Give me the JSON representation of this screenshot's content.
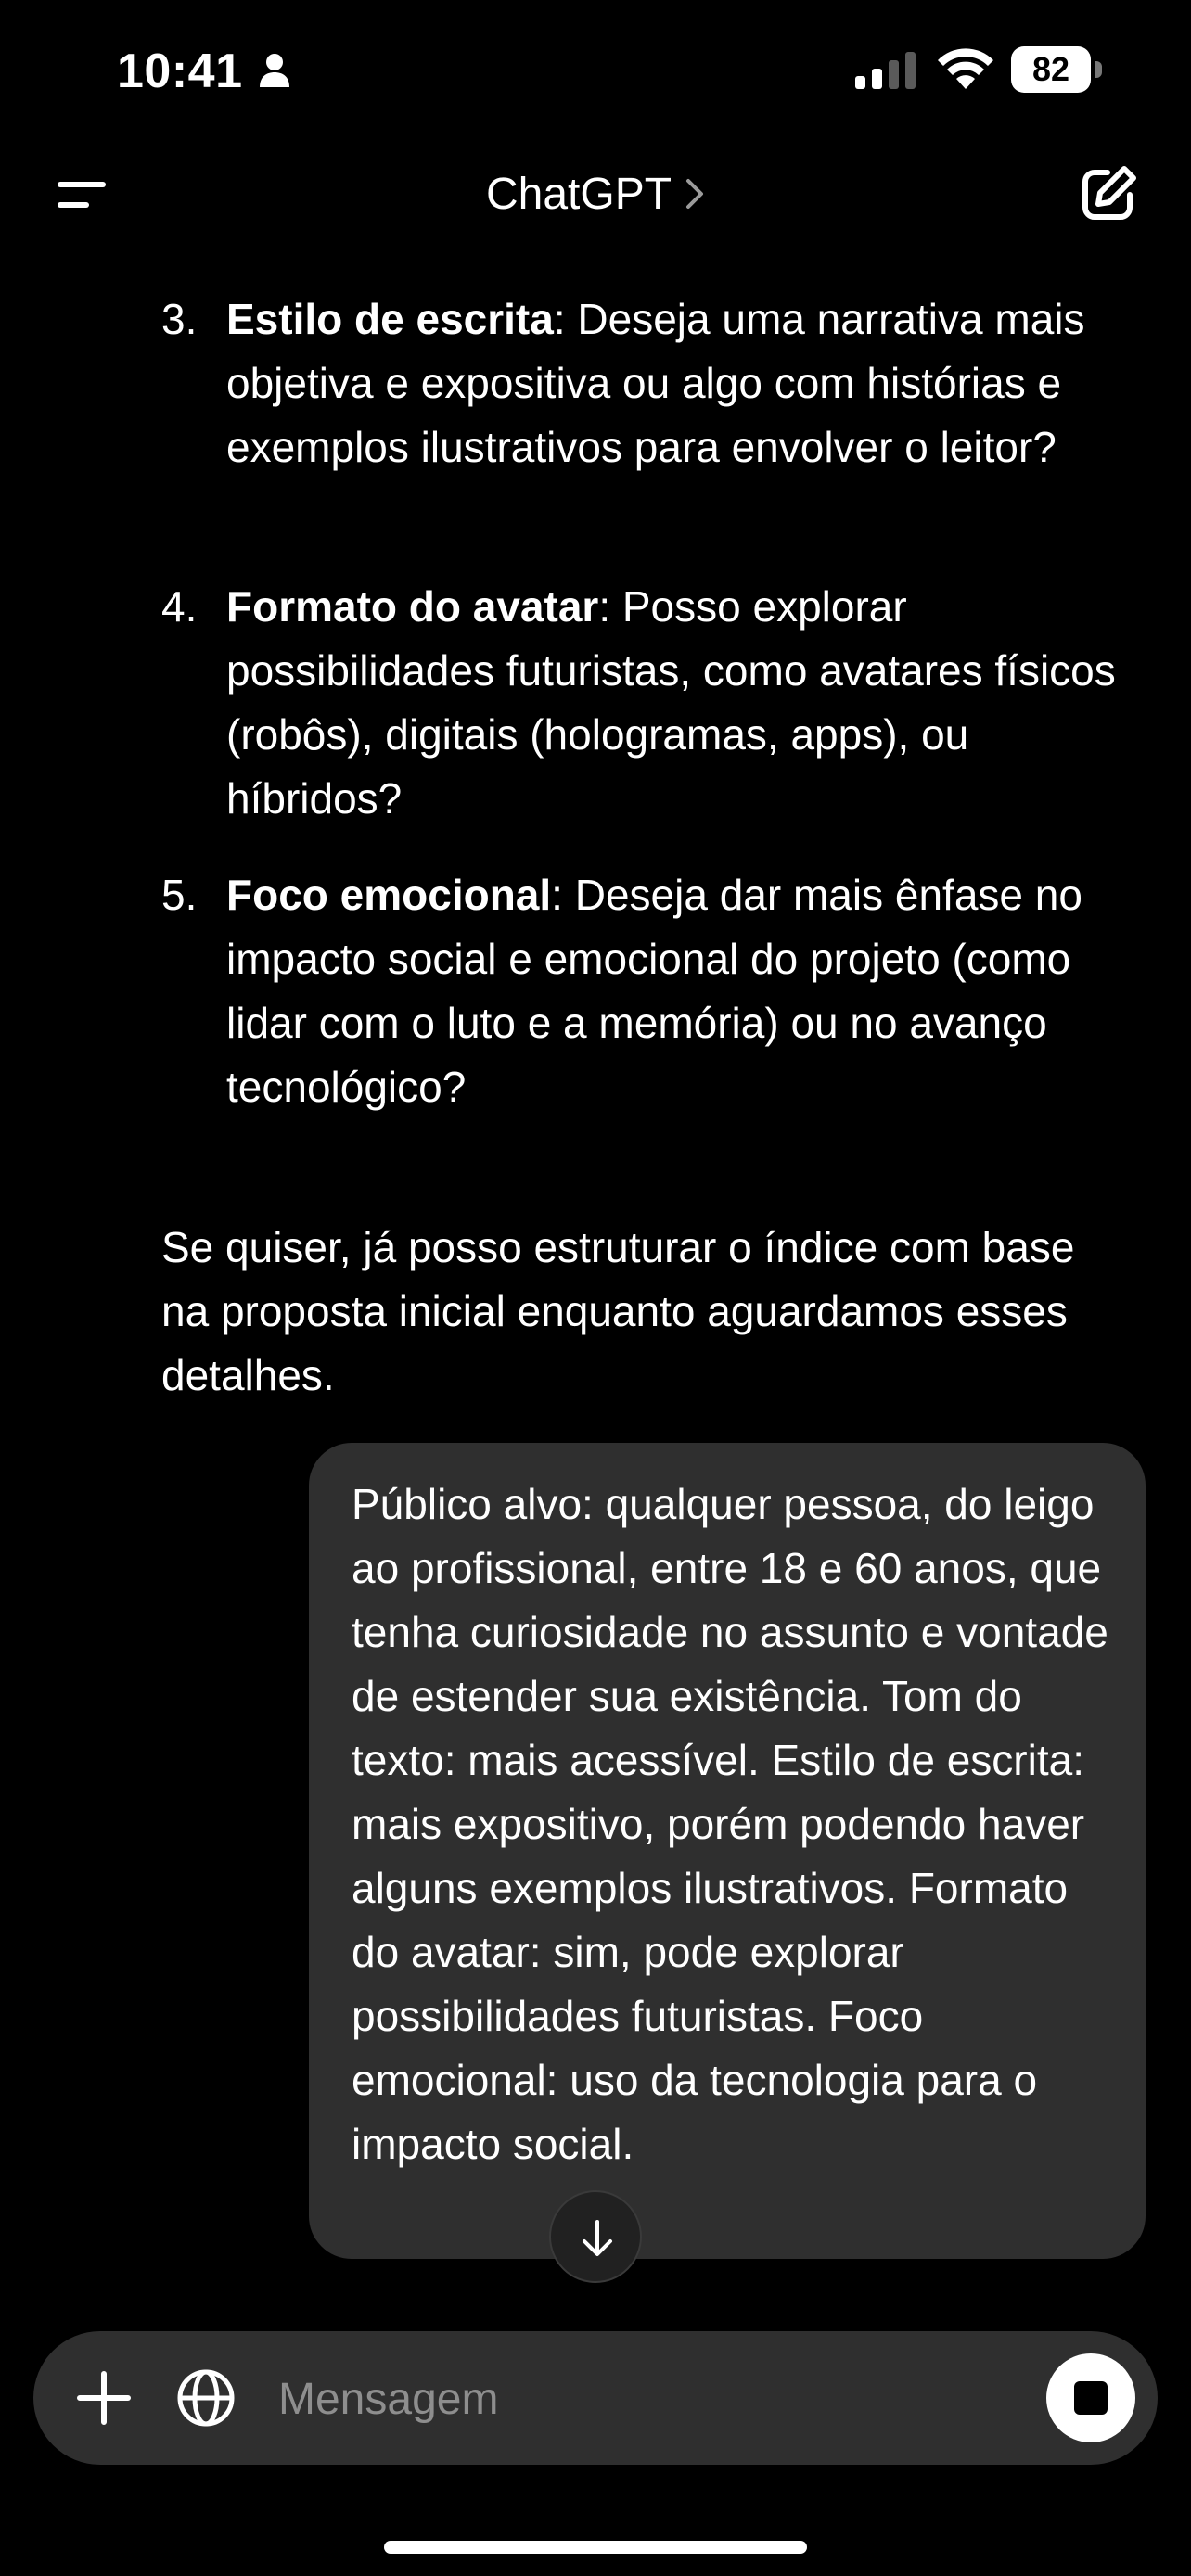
{
  "status_bar": {
    "time": "10:41",
    "battery": "82",
    "icons": [
      "person-icon",
      "cellular-signal-icon",
      "wifi-icon",
      "battery-icon"
    ]
  },
  "header": {
    "title": "ChatGPT",
    "icons": [
      "menu-icon",
      "chevron-right-icon",
      "new-chat-icon"
    ]
  },
  "assistant": {
    "list_items": [
      {
        "number": "3.",
        "term": "Estilo de escrita",
        "text": ": Deseja uma narrativa mais objetiva e expositiva ou algo com histórias e exemplos ilustrativos para envolver o leitor?"
      },
      {
        "number": "4.",
        "term": "Formato do avatar",
        "text": ": Posso explorar possibilidades futuristas, como avatares físicos (robôs), digitais (hologramas, apps), ou híbridos?"
      },
      {
        "number": "5.",
        "term": "Foco emocional",
        "text": ": Deseja dar mais ênfase no impacto social e emocional do projeto (como lidar com o luto e a memória) ou no avanço tecnológico?"
      }
    ],
    "closing": "Se quiser, já posso estruturar o índice com base na proposta inicial enquanto aguardamos esses detalhes."
  },
  "user_message": {
    "text": "Público alvo: qualquer pessoa, do leigo ao profissional, entre 18 e 60 anos, que tenha curiosidade no assunto e vontade de estender sua existência. Tom do texto: mais acessível. Estilo de escrita: mais expositivo, porém podendo haver alguns exemplos ilustrativos. Formato do avatar: sim, pode explorar possibilidades futuristas. Foco emocional: uso da tecnologia para o impacto social."
  },
  "composer": {
    "placeholder": "Mensagem",
    "icons": [
      "plus-icon",
      "globe-icon",
      "stop-icon"
    ]
  },
  "colors": {
    "background": "#000000",
    "bubble": "#2f2f2f",
    "text": "#ffffff",
    "placeholder": "#8e8e8e"
  }
}
